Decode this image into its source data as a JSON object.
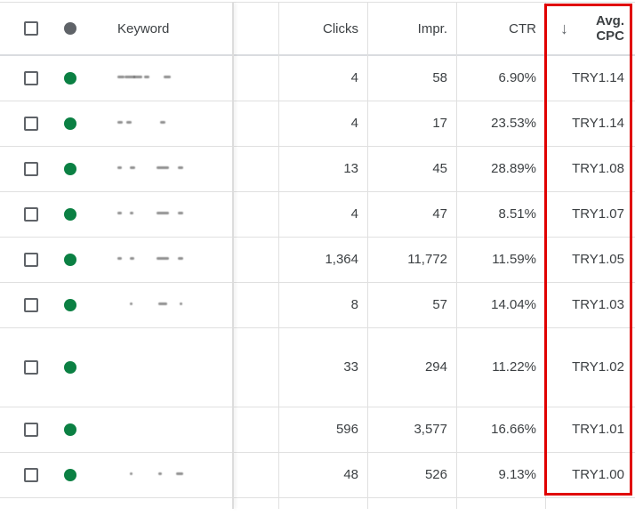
{
  "table": {
    "headers": {
      "keyword": "Keyword",
      "clicks": "Clicks",
      "impr": "Impr.",
      "ctr": "CTR",
      "avg_cpc_line1": "Avg.",
      "avg_cpc_line2": "CPC"
    },
    "sort": {
      "column": "Avg. CPC",
      "direction": "descending",
      "icon": "arrow-down-icon",
      "glyph": "↓"
    },
    "header_status_color": "#5f6368",
    "status_color": "#0b8043",
    "highlight_color": "#e00000",
    "rows": [
      {
        "keyword": "[redacted]",
        "status": "enabled",
        "clicks": "4",
        "impr": "58",
        "ctr": "6.90%",
        "avg_cpc": "TRY1.14"
      },
      {
        "keyword": "[redacted]",
        "status": "enabled",
        "clicks": "4",
        "impr": "17",
        "ctr": "23.53%",
        "avg_cpc": "TRY1.14"
      },
      {
        "keyword": "[redacted]",
        "status": "enabled",
        "clicks": "13",
        "impr": "45",
        "ctr": "28.89%",
        "avg_cpc": "TRY1.08"
      },
      {
        "keyword": "[redacted]",
        "status": "enabled",
        "clicks": "4",
        "impr": "47",
        "ctr": "8.51%",
        "avg_cpc": "TRY1.07"
      },
      {
        "keyword": "[redacted]",
        "status": "enabled",
        "clicks": "1,364",
        "impr": "11,772",
        "ctr": "11.59%",
        "avg_cpc": "TRY1.05"
      },
      {
        "keyword": "[redacted]",
        "status": "enabled",
        "clicks": "8",
        "impr": "57",
        "ctr": "14.04%",
        "avg_cpc": "TRY1.03"
      },
      {
        "keyword": "[redacted]",
        "status": "enabled",
        "clicks": "33",
        "impr": "294",
        "ctr": "11.22%",
        "avg_cpc": "TRY1.02"
      },
      {
        "keyword": "[redacted]",
        "status": "enabled",
        "clicks": "596",
        "impr": "3,577",
        "ctr": "16.66%",
        "avg_cpc": "TRY1.01"
      },
      {
        "keyword": "[redacted]",
        "status": "enabled",
        "clicks": "48",
        "impr": "526",
        "ctr": "9.13%",
        "avg_cpc": "TRY1.00"
      }
    ]
  }
}
